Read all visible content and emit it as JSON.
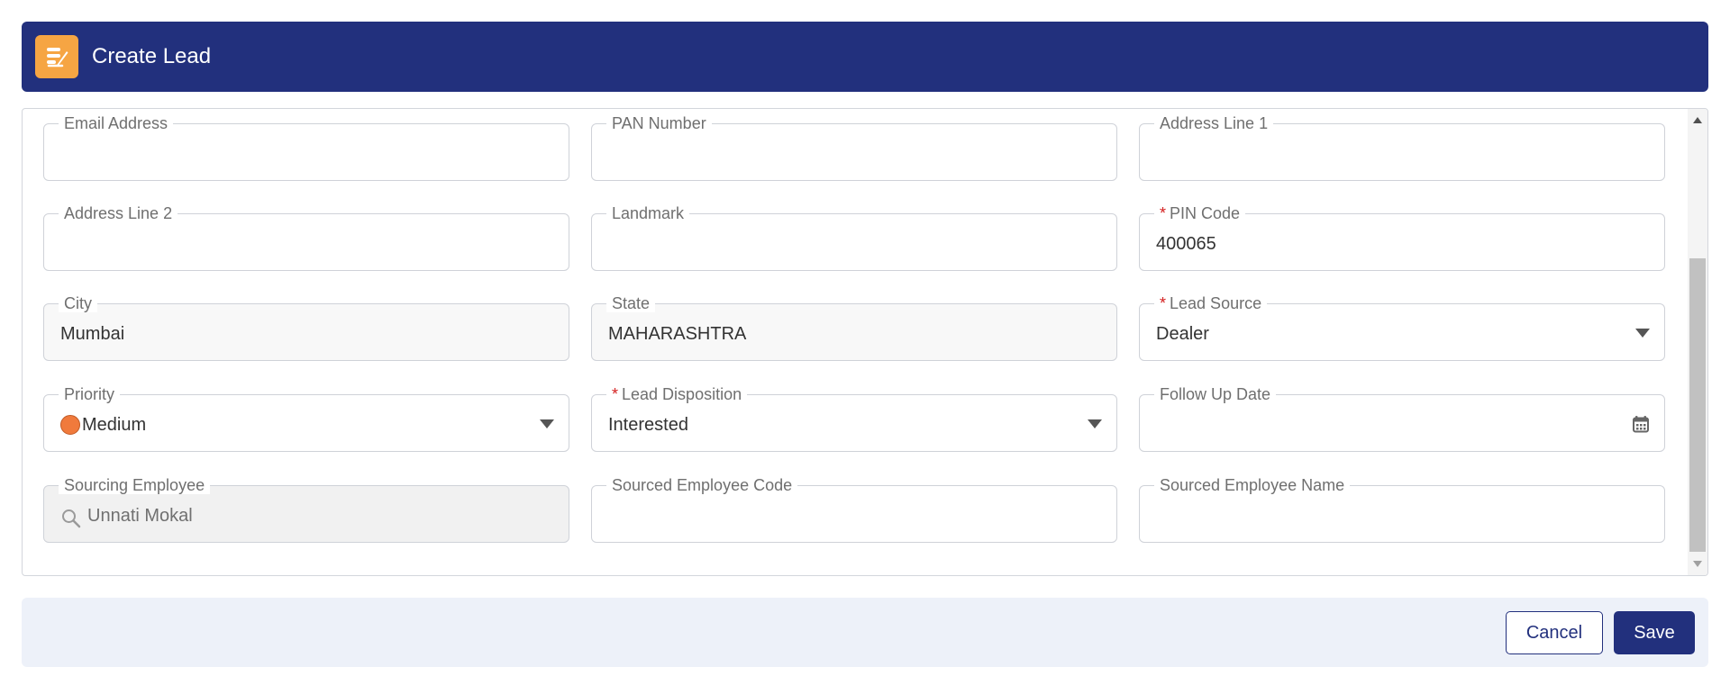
{
  "header": {
    "title": "Create Lead",
    "icon": "lead-form-icon",
    "background_color": "#22307d",
    "icon_color": "#f6a543"
  },
  "fields": {
    "email": {
      "label": "Email Address",
      "value": ""
    },
    "pan": {
      "label": "PAN Number",
      "value": ""
    },
    "address1": {
      "label": "Address Line 1",
      "value": ""
    },
    "address2": {
      "label": "Address Line 2",
      "value": ""
    },
    "landmark": {
      "label": "Landmark",
      "value": ""
    },
    "pin": {
      "label": "PIN Code",
      "required_mark": "*",
      "value": "400065"
    },
    "city": {
      "label": "City",
      "value": "Mumbai"
    },
    "state": {
      "label": "State",
      "value": "MAHARASHTRA"
    },
    "lead_source": {
      "label": "Lead Source",
      "required_mark": "*",
      "value": "Dealer"
    },
    "priority": {
      "label": "Priority",
      "value": "Medium",
      "dot_color": "#f07a3c"
    },
    "lead_disposition": {
      "label": "Lead Disposition",
      "required_mark": "*",
      "value": "Interested"
    },
    "follow_up_date": {
      "label": "Follow Up Date",
      "value": ""
    },
    "sourcing_employee": {
      "label": "Sourcing Employee",
      "value": "Unnati Mokal"
    },
    "sourced_employee_code": {
      "label": "Sourced Employee Code",
      "value": ""
    },
    "sourced_employee_name": {
      "label": "Sourced Employee Name",
      "value": ""
    }
  },
  "footer": {
    "cancel_label": "Cancel",
    "save_label": "Save"
  },
  "colors": {
    "brand": "#22307d",
    "required": "#d42020",
    "footer_background": "#edf1f9"
  }
}
